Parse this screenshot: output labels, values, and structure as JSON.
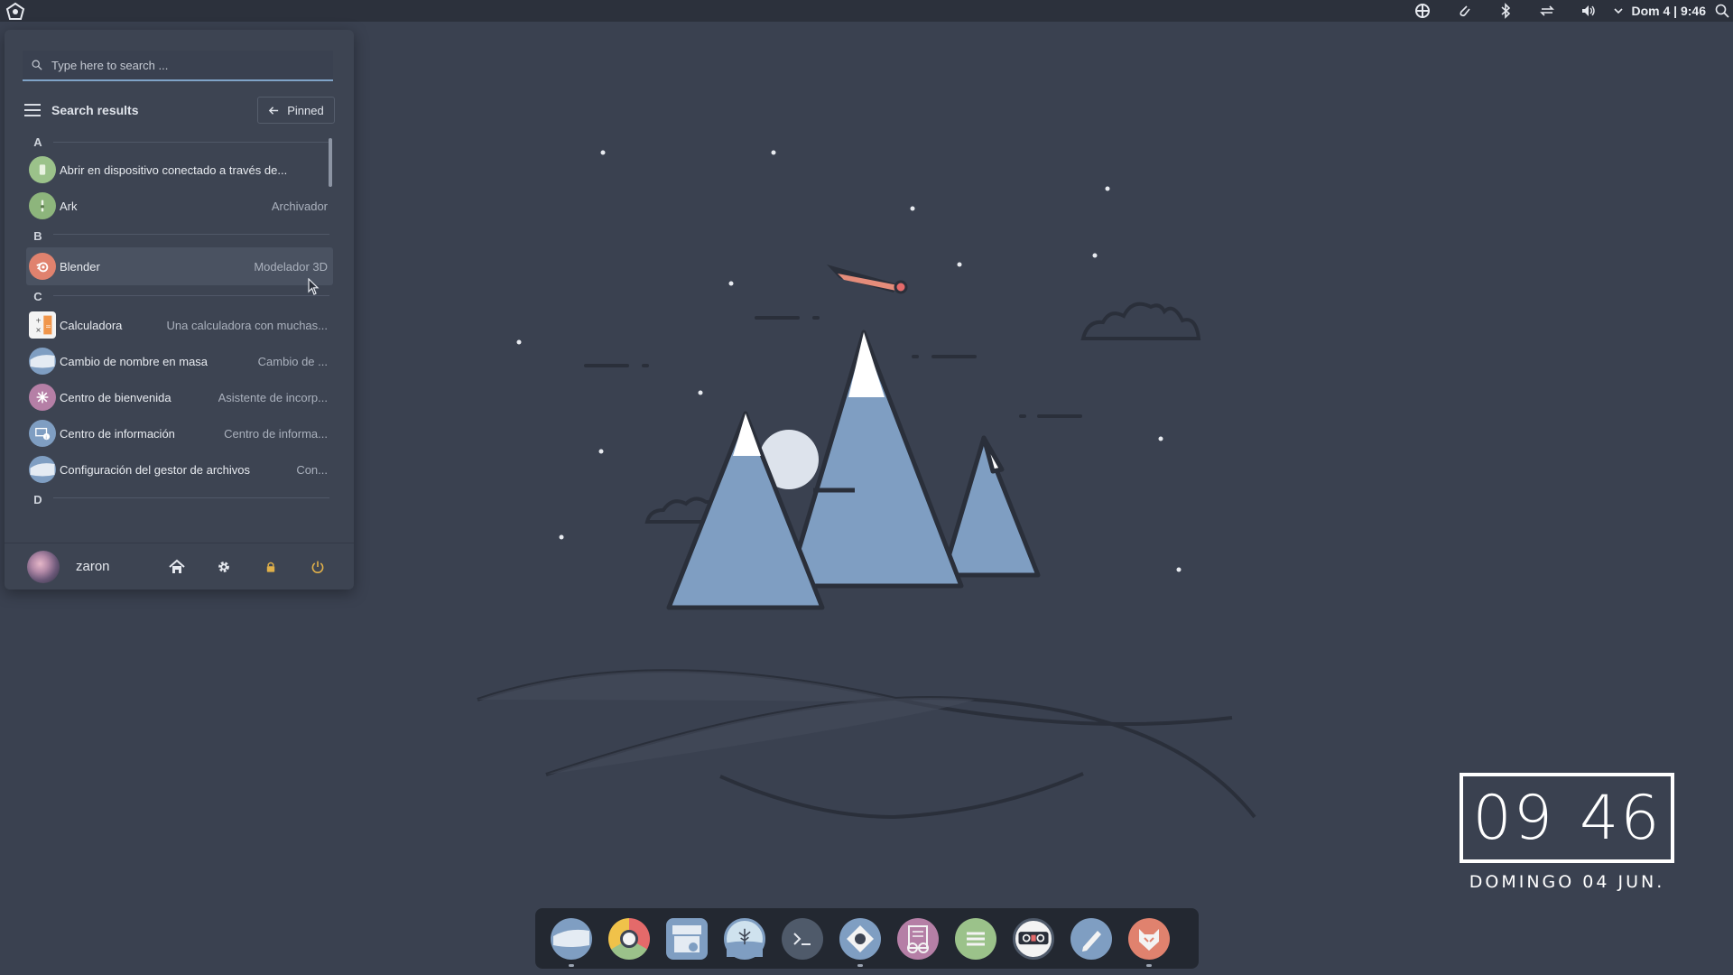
{
  "top_panel": {
    "clock": "Dom 4 | 9:46",
    "icons": [
      "app-launcher-icon",
      "network-icon",
      "clipboard-icon",
      "bluetooth-icon",
      "kdeconnect-icon",
      "volume-icon",
      "chevron-down-icon",
      "search-icon"
    ]
  },
  "menu": {
    "search_placeholder": "Type here to search ...",
    "results_title": "Search results",
    "pinned_label": "Pinned",
    "sections": [
      {
        "letter": "A",
        "items": [
          {
            "name": "Abrir en dispositivo conectado a través de...",
            "desc": "",
            "icon": "kdeconnect-app-icon"
          },
          {
            "name": "Ark",
            "desc": "Archivador",
            "icon": "ark-icon"
          }
        ]
      },
      {
        "letter": "B",
        "items": [
          {
            "name": "Blender",
            "desc": "Modelador 3D",
            "icon": "blender-icon"
          }
        ]
      },
      {
        "letter": "C",
        "items": [
          {
            "name": "Calculadora",
            "desc": "Una calculadora con muchas...",
            "icon": "calculator-icon"
          },
          {
            "name": "Cambio de nombre en masa",
            "desc": "Cambio de ...",
            "icon": "folder-icon"
          },
          {
            "name": "Centro de bienvenida",
            "desc": "Asistente de incorp...",
            "icon": "welcome-icon"
          },
          {
            "name": "Centro de información",
            "desc": "Centro de informa...",
            "icon": "info-center-icon"
          },
          {
            "name": "Configuración del gestor de archivos",
            "desc": "Con...",
            "icon": "folder-icon"
          }
        ]
      },
      {
        "letter": "D",
        "items": []
      }
    ],
    "user": {
      "name": "zaron"
    }
  },
  "dock": {
    "apps": [
      "file-manager-icon",
      "chromium-icon",
      "software-center-icon",
      "image-viewer-icon",
      "terminal-icon",
      "settings-app-icon",
      "text-viewer-icon",
      "notes-icon",
      "obs-icon",
      "editor-icon",
      "firefox-icon"
    ]
  },
  "clock_widget": {
    "hours": "09",
    "minutes": "46",
    "date": "DOMINGO 04 JUN."
  },
  "colors": {
    "desktop_bg": "#3a4150",
    "panel_bg": "#2c313c",
    "menu_bg": "#3d4452",
    "accent": "#7fa3c7",
    "mountain": "#7f9ec2"
  }
}
